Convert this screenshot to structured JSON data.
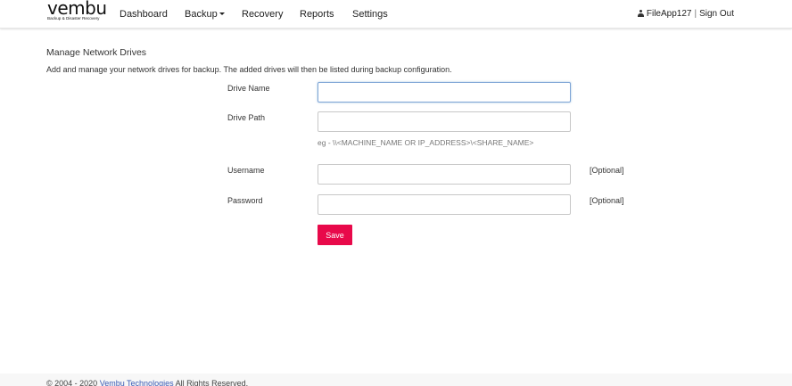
{
  "brand": {
    "logo_text": "vembu",
    "tagline": "Backup & Disaster Recovery"
  },
  "nav": {
    "items": [
      {
        "label": "Dashboard"
      },
      {
        "label": "Backup"
      },
      {
        "label": "Recovery"
      },
      {
        "label": "Reports"
      },
      {
        "label": "Settings"
      }
    ],
    "user": "FileApp127",
    "separator": "|",
    "signout": "Sign Out"
  },
  "page": {
    "title": "Manage Network Drives",
    "description": "Add and manage your network drives for backup. The added drives will then be listed during backup configuration."
  },
  "form": {
    "drive_name": {
      "label": "Drive Name",
      "value": ""
    },
    "drive_path": {
      "label": "Drive Path",
      "value": "",
      "hint": "eg - \\\\<MACHINE_NAME OR IP_ADDRESS>\\<SHARE_NAME>"
    },
    "username": {
      "label": "Username",
      "value": "",
      "note": "[Optional]"
    },
    "password": {
      "label": "Password",
      "value": "",
      "note": "[Optional]"
    },
    "save_label": "Save"
  },
  "footer": {
    "prefix": "© 2004 - 2020 ",
    "link": "Vembu Technologies",
    "suffix": " All Rights Reserved."
  },
  "colors": {
    "accent": "#e8094a",
    "link": "#3b5bb5",
    "focus_border": "#7fa6d6"
  }
}
